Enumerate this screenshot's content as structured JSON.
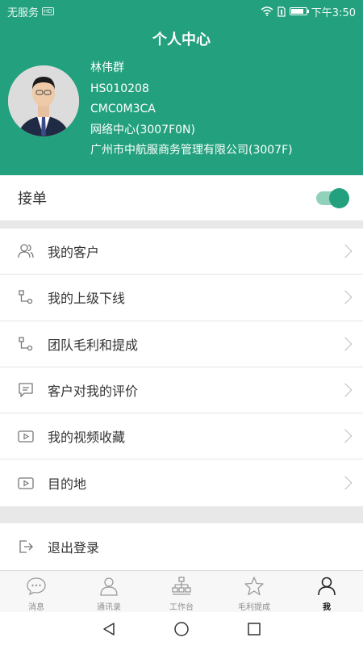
{
  "status_bar": {
    "carrier": "无服务",
    "sim": "HD",
    "time": "下午3:50",
    "battery_level": 0.85
  },
  "header": {
    "title": "个人中心"
  },
  "profile": {
    "name": "林伟群",
    "employee_id": "HS010208",
    "code": "CMC0M3CA",
    "department": "网络中心(3007F0N)",
    "company": "广州市中航服商务管理有限公司(3007F)"
  },
  "order_toggle": {
    "label": "接单",
    "enabled": true
  },
  "menu": {
    "items": [
      {
        "label": "我的客户",
        "icon": "users-icon"
      },
      {
        "label": "我的上级下线",
        "icon": "hierarchy-icon"
      },
      {
        "label": "团队毛利和提成",
        "icon": "hierarchy-icon"
      },
      {
        "label": "客户对我的评价",
        "icon": "comment-icon"
      },
      {
        "label": "我的视频收藏",
        "icon": "video-icon"
      },
      {
        "label": "目的地",
        "icon": "video-icon"
      }
    ]
  },
  "logout": {
    "label": "退出登录",
    "icon": "logout-icon"
  },
  "tabs": [
    {
      "label": "消息",
      "icon": "chat-icon"
    },
    {
      "label": "通讯录",
      "icon": "contacts-icon"
    },
    {
      "label": "工作台",
      "icon": "workbench-icon"
    },
    {
      "label": "毛利提成",
      "icon": "star-icon"
    },
    {
      "label": "我",
      "icon": "person-icon",
      "active": true
    }
  ],
  "colors": {
    "primary": "#23a17e",
    "toggle_track": "#91d1bc",
    "background": "#e8e8e8"
  }
}
